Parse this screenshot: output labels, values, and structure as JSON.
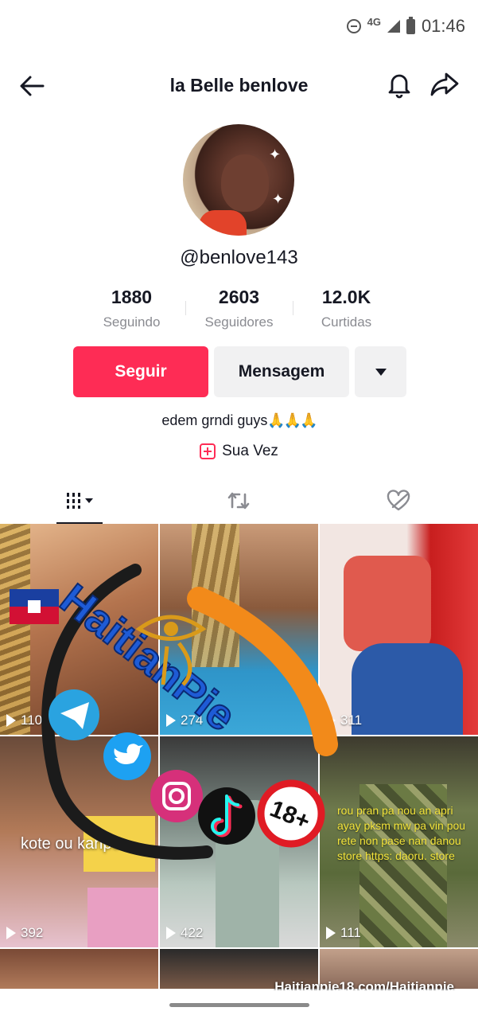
{
  "status_bar": {
    "network": "4G",
    "time": "01:46"
  },
  "header": {
    "title": "la Belle benlove"
  },
  "profile": {
    "handle": "@benlove143",
    "stats": [
      {
        "value": "1880",
        "label": "Seguindo"
      },
      {
        "value": "2603",
        "label": "Seguidores"
      },
      {
        "value": "12.0K",
        "label": "Curtidas"
      }
    ],
    "follow_label": "Seguir",
    "message_label": "Mensagem",
    "bio": "edem grndi guys",
    "bio_emoji": "🙏🙏🙏",
    "link_label": "Sua Vez"
  },
  "videos": [
    {
      "views": "110",
      "overlay": ""
    },
    {
      "views": "274",
      "overlay": ""
    },
    {
      "views": "311",
      "overlay": ""
    },
    {
      "views": "392",
      "overlay": "kote ou kanpe"
    },
    {
      "views": "422",
      "overlay": ""
    },
    {
      "views": "111",
      "overlay": "rou pran pa nou an apri ayay pksm mw pa vin pou rete non pase nan danou store https: daoru. store"
    }
  ],
  "watermark": {
    "brand": "HaitianPie",
    "badge": "18+",
    "url": "Haitianpie18.com/Haitianpie"
  },
  "colors": {
    "accent": "#fe2c55",
    "watermark_blue": "#1e5bd6",
    "watermark_orange": "#f28a1a"
  }
}
